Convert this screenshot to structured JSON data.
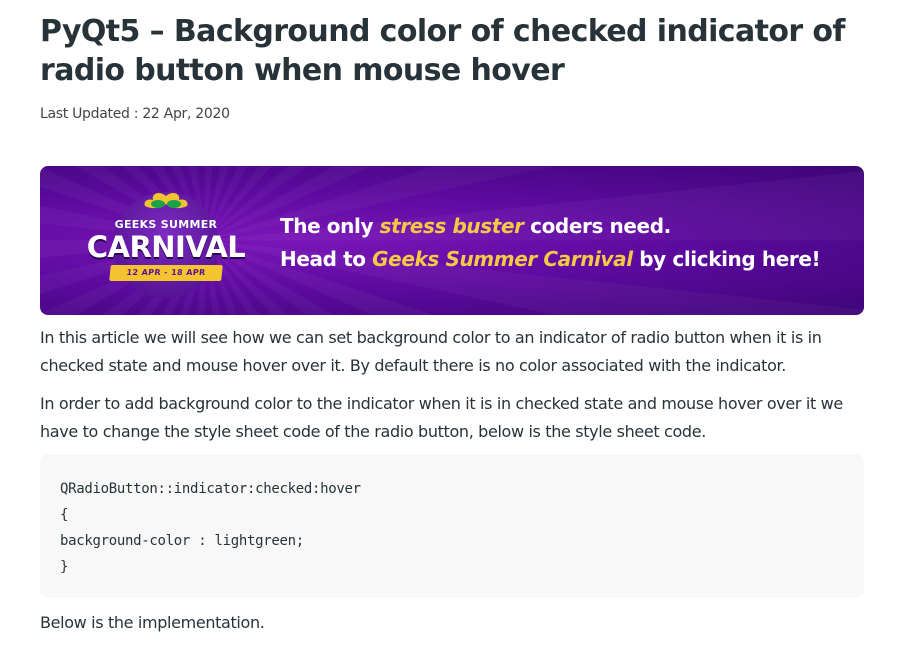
{
  "article": {
    "title": "PyQt5 – Background color of checked indicator of radio button when mouse hover",
    "last_updated": "Last Updated : 22 Apr, 2020"
  },
  "banner": {
    "logo_small": "GEEKS SUMMER",
    "logo_big": "CARNIVAL",
    "logo_dates": "12 APR - 18 APR",
    "line1_pre": "The only ",
    "line1_highlight": "stress buster",
    "line1_post": " coders need.",
    "line2_pre": "Head to ",
    "line2_highlight": "Geeks Summer Carnival",
    "line2_post": " by clicking here!",
    "colors": {
      "background": "#5e0aa0",
      "highlight": "#f6c945",
      "text": "#ffffff"
    }
  },
  "content": {
    "para1": "In this article we will see how we can set background color to an indicator of radio button when it is in checked state and mouse hover over it. By default there is no color associated with the indicator.",
    "para2": "In order to add background color to the indicator when it is in checked state and mouse hover over it we have to change the style sheet code of the radio button, below is the style sheet code.",
    "code": "QRadioButton::indicator:checked:hover\n{\nbackground-color : lightgreen;\n}",
    "para3": "Below is the implementation."
  }
}
